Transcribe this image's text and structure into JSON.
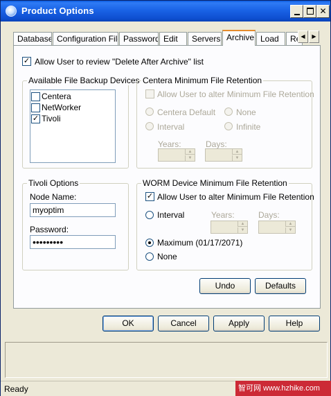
{
  "window": {
    "title": "Product Options"
  },
  "tabs": [
    "Database",
    "Configuration File",
    "Password",
    "Edit",
    "Servers",
    "Archive",
    "Load",
    "Re"
  ],
  "active_tab": "Archive",
  "archive": {
    "allow_review_label": "Allow User to review \"Delete After Archive\" list",
    "backup_devices": {
      "title": "Available File Backup Devices",
      "items": [
        {
          "label": "Centera",
          "checked": false
        },
        {
          "label": "NetWorker",
          "checked": false
        },
        {
          "label": "Tivoli",
          "checked": true
        }
      ]
    },
    "centera": {
      "title": "Centera Minimum File Retention",
      "allow_alter_label": "Allow User to alter Minimum File Retention",
      "centera_default": "Centera Default",
      "none": "None",
      "interval": "Interval",
      "infinite": "Infinite",
      "years": "Years:",
      "days": "Days:"
    },
    "tivoli": {
      "title": "Tivoli Options",
      "node_label": "Node Name:",
      "node_value": "myoptim",
      "password_label": "Password:",
      "password_value": "•••••••••"
    },
    "worm": {
      "title": "WORM Device Minimum File Retention",
      "allow_alter_label": "Allow User to alter Minimum File Retention",
      "interval": "Interval",
      "years": "Years:",
      "days": "Days:",
      "maximum": "Maximum (01/17/2071)",
      "none": "None"
    },
    "undo": "Undo",
    "defaults": "Defaults"
  },
  "footer_buttons": {
    "ok": "OK",
    "cancel": "Cancel",
    "apply": "Apply",
    "help": "Help"
  },
  "status": "Ready",
  "watermark": "智可网 www.hzhike.com"
}
